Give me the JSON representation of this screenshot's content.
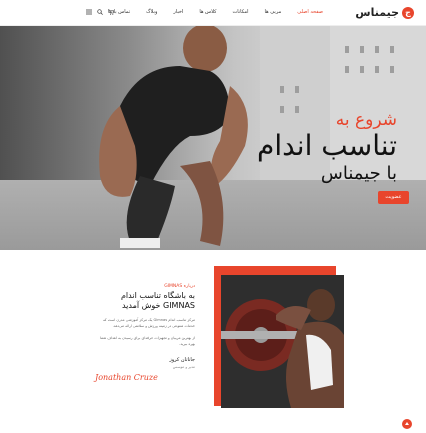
{
  "header": {
    "logo": {
      "mark": "ج",
      "name": "جیمناس"
    },
    "nav": [
      {
        "label": "صفحه اصلی",
        "active": true
      },
      {
        "label": "مربی ها",
        "active": false
      },
      {
        "label": "امکانات",
        "active": false
      },
      {
        "label": "کلاس ها",
        "active": false
      },
      {
        "label": "اخبار",
        "active": false
      },
      {
        "label": "وبلاگ",
        "active": false
      },
      {
        "label": "تماس با ما",
        "active": false
      }
    ],
    "icons": [
      "menu-icon",
      "search-icon",
      "cart-icon"
    ]
  },
  "hero": {
    "line1": "شروع به",
    "line2": "تناسب اندام",
    "line3": "با جیمناس",
    "button": "عضویت"
  },
  "about": {
    "tag": "درباره GIMNAS",
    "title": "به باشگاه تناسب اندام GIMNAS خوش آمدید",
    "p1": "مرکز تناسب اندام Gimnas یک مرکز آموزشی مدرن است که خدمات متنوعی در زمینه ورزش و سلامتی ارائه می‌دهد.",
    "p2": "از بهترین مربیان و تجهیزات حرفه‌ای برای رسیدن به اهداف شما بهره ببرید.",
    "author": "جاناتان کروز",
    "role": "مدیر و موسس",
    "signature": "Jonathan Cruze"
  },
  "colors": {
    "accent": "#e8452c",
    "text": "#111111"
  }
}
